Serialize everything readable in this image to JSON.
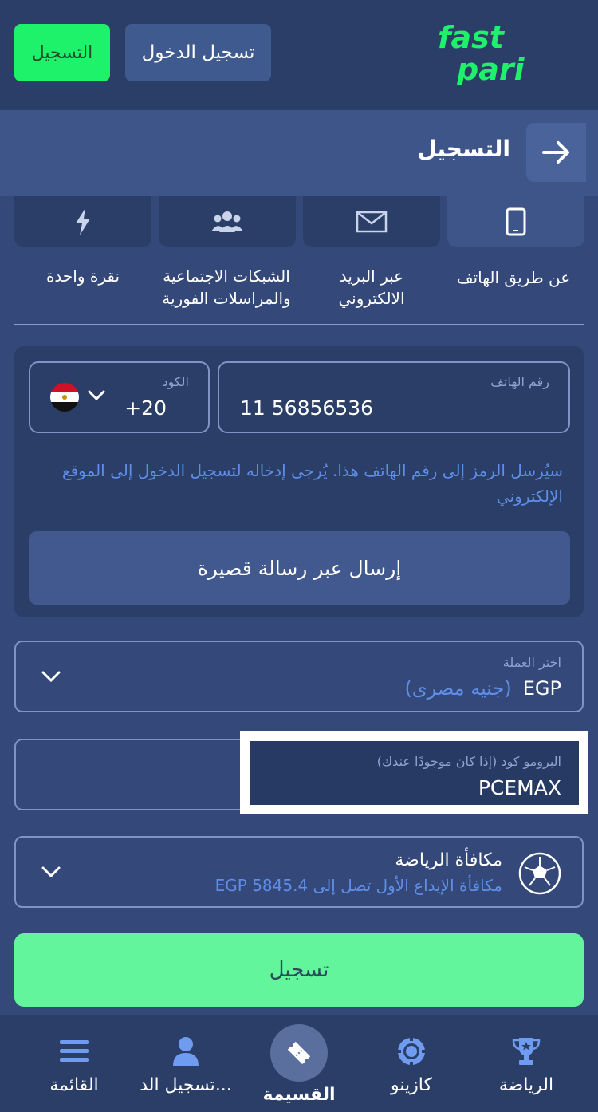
{
  "topbar": {
    "register_label": "التسجيل",
    "login_label": "تسجيل الدخول",
    "logo_line1": "fast",
    "logo_line2": "pari",
    "logo_color": "#1df26a"
  },
  "header": {
    "title": "التسجيل",
    "back_icon": "arrow-right-icon"
  },
  "methods": [
    {
      "label": "عن طريق الهاتف",
      "icon": "phone-icon",
      "active": true
    },
    {
      "label_line1": "عبر البريد",
      "label_line2": "الالكتروني",
      "icon": "mail-icon"
    },
    {
      "label_line1": "الشبكات الاجتماعية",
      "label_line2": "والمراسلات الفورية",
      "icon": "users-icon"
    },
    {
      "label": "نقرة واحدة",
      "icon": "lightning-icon"
    }
  ],
  "phone": {
    "code_label": "الكود",
    "code_value": "+20",
    "country_flag": "egypt-flag-icon",
    "number_label": "رقم الهاتف",
    "number_value": "11 56856536",
    "hint": "سيُرسل الرمز إلى رقم الهاتف هذا. يُرجى إدخاله لتسجيل الدخول إلى الموقع الإلكتروني",
    "sms_button": "إرسال عبر رسالة قصيرة"
  },
  "currency": {
    "label": "اختر العملة",
    "code": "EGP",
    "name": "(جنيه مصرى)"
  },
  "promo": {
    "label": "البرومو كود (إذا كان موجودًا عندك)",
    "value": "PCEMAX"
  },
  "bonus": {
    "title": "مكافأة الرياضة",
    "subtitle": "مكافأة الإيداع الأول تصل إلى 5845.4 EGP",
    "icon": "football-icon"
  },
  "submit_label": "تسجيل",
  "nav": {
    "sports": "الرياضة",
    "casino": "كازينو",
    "coupon": "القسيمة",
    "login": "تسجيل الد...",
    "menu": "القائمة"
  },
  "colors": {
    "background": "#34497a",
    "accent_green": "#1df26a",
    "submit_green": "#62f59b",
    "link_blue": "#5f8ee8"
  }
}
